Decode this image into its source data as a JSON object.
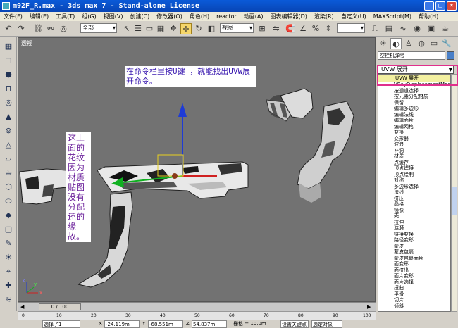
{
  "window": {
    "title": "m92F_R.max - 3ds max 7 - Stand-alone License",
    "min": "_",
    "max": "□",
    "close": "×"
  },
  "menu": [
    "文件(F)",
    "编辑(E)",
    "工具(T)",
    "组(G)",
    "视图(V)",
    "创建(C)",
    "修改器(O)",
    "角色(H)",
    "reactor",
    "动画(A)",
    "图表编辑器(D)",
    "渲染(R)",
    "自定义(U)",
    "MAXScript(M)",
    "帮助(H)"
  ],
  "toolbar": {
    "selection_filter": "全部",
    "coord_system": "视图"
  },
  "viewport": {
    "label": "透视",
    "note_top": "在命令栏里按U键 ，就能找出UVW展开命令。",
    "note_vertical": "这上面的花纹因为材质贴图没有分配还的缘故。",
    "axis_x": "x",
    "axis_y": "y",
    "axis_z": "z"
  },
  "command_panel": {
    "object_name": "空挂机弹险",
    "modifier_combo": "UVW 展开",
    "modifiers": [
      "UVW 展开",
      "VRayDisplacementMod",
      "按通道选择",
      "按元素分配材质",
      "保留",
      "编辑多边形",
      "编辑法线",
      "编辑面片",
      "编辑网格",
      "变换",
      "变形器",
      "波浪",
      "补洞",
      "材质",
      "点缓存",
      "顶点焊接",
      "顶点绘制",
      "对称",
      "多边形选择",
      "法线",
      "挤压",
      "晶格",
      "镜像",
      "壳",
      "拉伸",
      "涟漪",
      "链接变换",
      "路径变形",
      "蒙皮",
      "蒙皮包裹",
      "蒙皮包裹面片",
      "面变形",
      "面挤出",
      "面片变形",
      "面片选择",
      "扭曲",
      "平滑",
      "切片",
      "倾斜"
    ]
  },
  "timeline": {
    "frame": "0 / 100"
  },
  "ruler": [
    "0",
    "10",
    "20",
    "30",
    "40",
    "50",
    "60",
    "70",
    "80",
    "90",
    "100"
  ],
  "status": {
    "selected": "选择了1",
    "x": "-24.119m",
    "y": "-68.551m",
    "z": "54.837m",
    "grid": "栅格 = 10.0m",
    "keymode": "设置关键点",
    "keyfilter": "选定对象"
  },
  "colors": {
    "note_top_text": "#3b1bb0",
    "note_vert_text": "#6a1f9a",
    "highlight": "#e02f8c",
    "title_bar": "#0a5ad8"
  }
}
